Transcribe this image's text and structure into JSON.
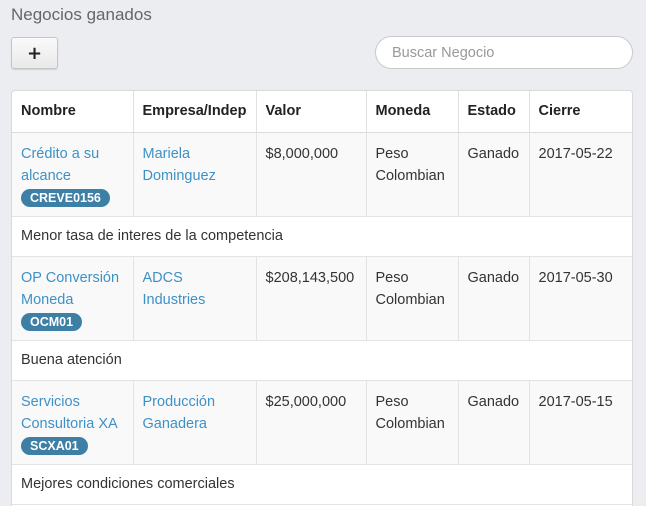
{
  "header": {
    "title": "Negocios ganados",
    "add_label": "+"
  },
  "search": {
    "placeholder": "Buscar Negocio",
    "value": ""
  },
  "table": {
    "columns": [
      "Nombre",
      "Empresa/Indep",
      "Valor",
      "Moneda",
      "Estado",
      "Cierre"
    ],
    "rows": [
      {
        "name_line1": "Crédito a su",
        "name_line2": "alcance",
        "code": "CREVE0156",
        "company_line1": "Mariela",
        "company_line2": "Dominguez",
        "value": "$8,000,000",
        "currency_line1": "Peso",
        "currency_line2": "Colombian",
        "status": "Ganado",
        "close_date": "2017-05-22",
        "note": "Menor tasa de interes de la competencia"
      },
      {
        "name_line1": "OP Conversión",
        "name_line2": "Moneda",
        "code": "OCM01",
        "company_line1": "ADCS",
        "company_line2": "Industries",
        "value": "$208,143,500",
        "currency_line1": "Peso",
        "currency_line2": "Colombian",
        "status": "Ganado",
        "close_date": "2017-05-30",
        "note": "Buena atención"
      },
      {
        "name_line1": "Servicios",
        "name_line2": "Consultoria XA",
        "code": "SCXA01",
        "company_line1": "Producción",
        "company_line2": "Ganadera",
        "value": "$25,000,000",
        "currency_line1": "Peso",
        "currency_line2": "Colombian",
        "status": "Ganado",
        "close_date": "2017-05-15",
        "note": "Mejores condiciones comerciales"
      }
    ]
  }
}
